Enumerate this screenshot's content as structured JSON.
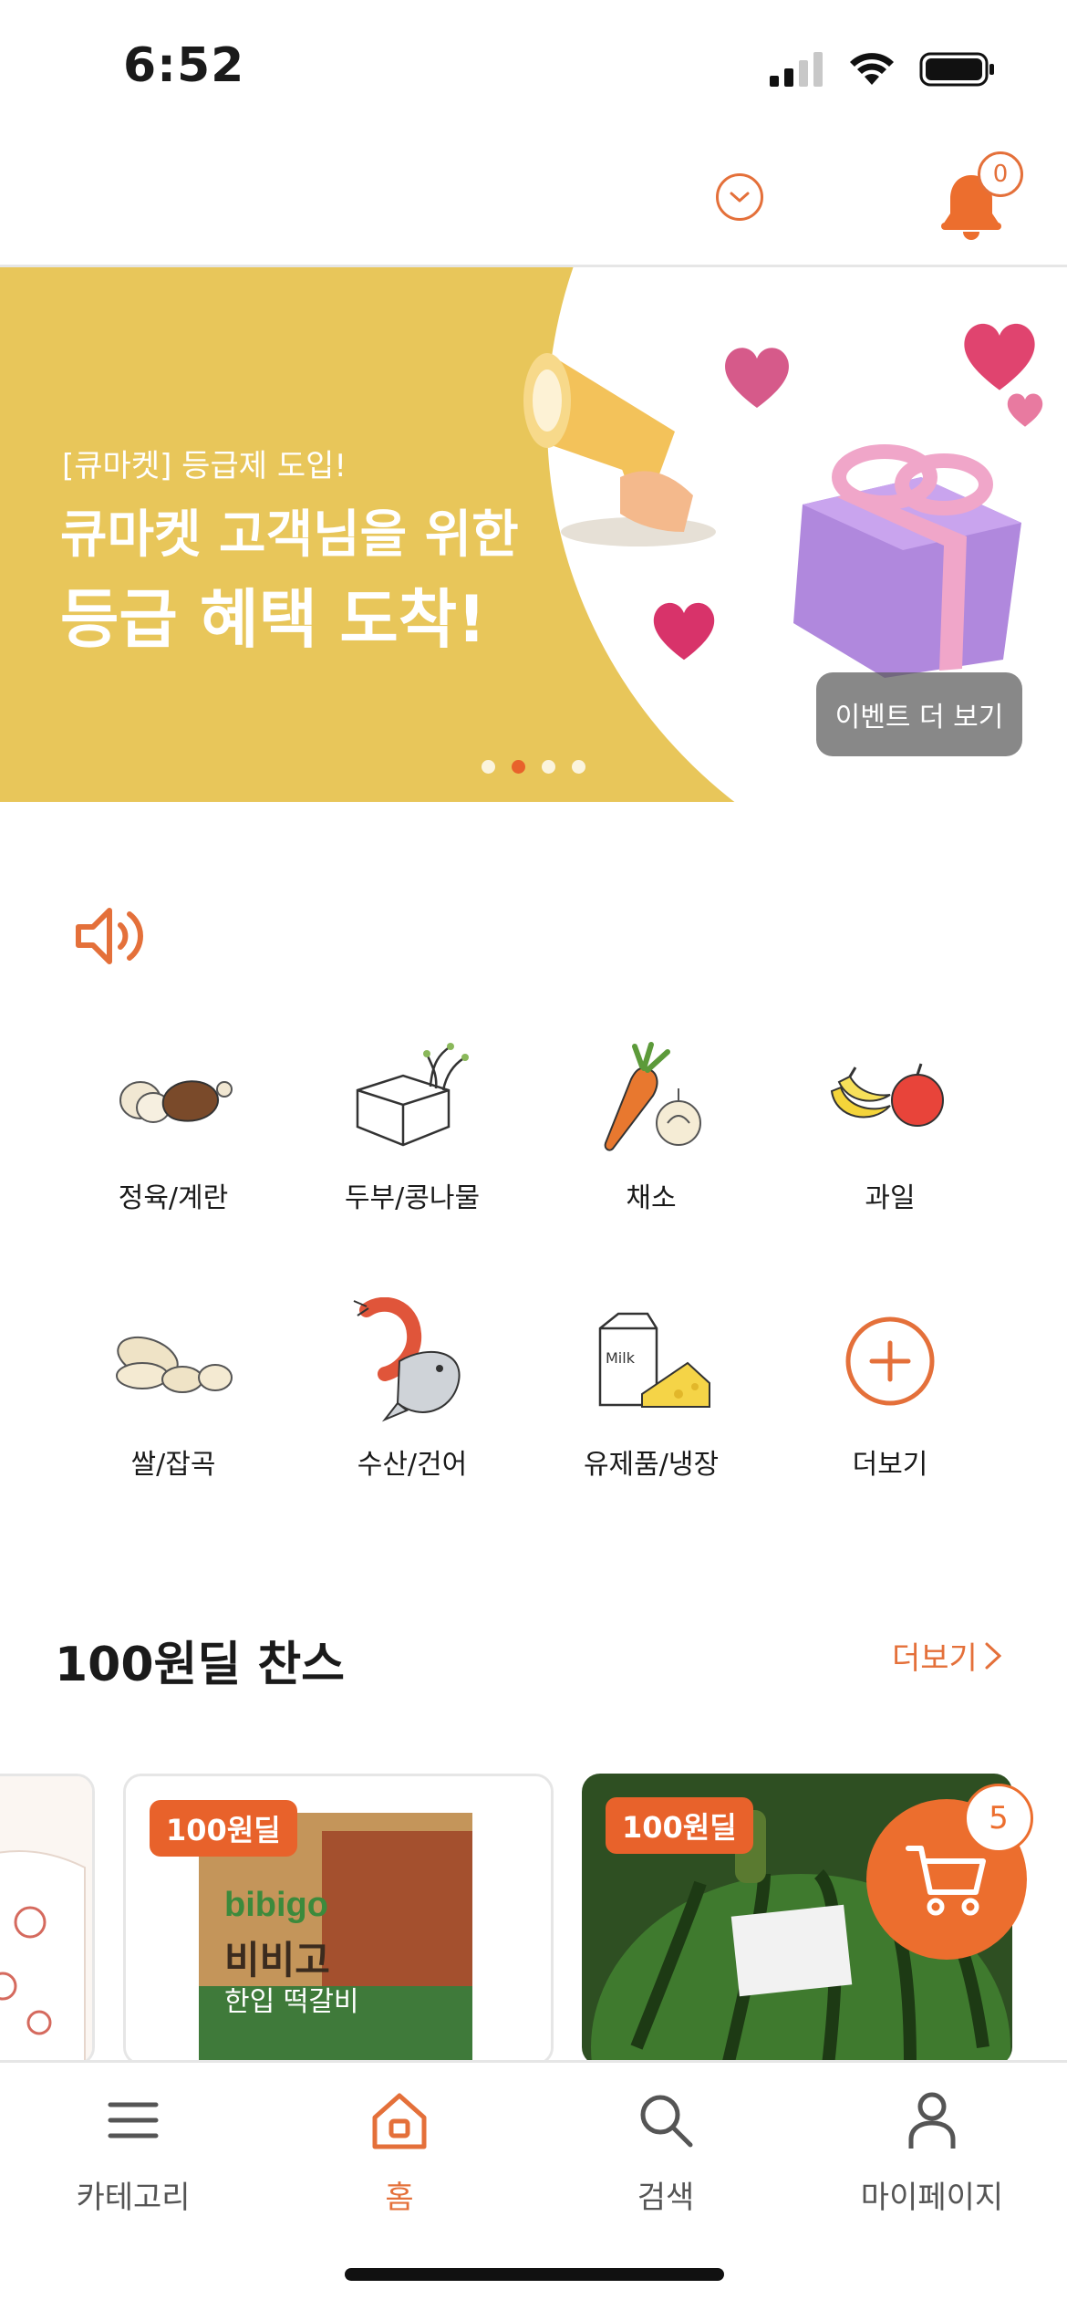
{
  "status_bar": {
    "time": "6:52"
  },
  "header": {
    "notification_count": "0"
  },
  "banner": {
    "subtitle": "[큐마켓] 등급제 도입!",
    "title_line1": "큐마켓 고객님을 위한",
    "title_line2": "등급 혜택 도착!",
    "event_button": "이벤트 더 보기",
    "page_count": 4,
    "active_page": 2
  },
  "categories": [
    {
      "label": "정육/계란",
      "icon": "meat-egg-icon"
    },
    {
      "label": "두부/콩나물",
      "icon": "tofu-sprout-icon"
    },
    {
      "label": "채소",
      "icon": "vegetable-icon"
    },
    {
      "label": "과일",
      "icon": "fruit-icon"
    },
    {
      "label": "쌀/잡곡",
      "icon": "grain-icon"
    },
    {
      "label": "수산/건어",
      "icon": "seafood-icon"
    },
    {
      "label": "유제품/냉장",
      "icon": "dairy-icon"
    },
    {
      "label": "더보기",
      "icon": "plus-circle-icon"
    }
  ],
  "deal_section": {
    "title": "100원딜 찬스",
    "more_label": "더보기",
    "products": [
      {
        "badge": ""
      },
      {
        "badge": "100원딜",
        "brand_text": "bibigo",
        "product_text": "비비고",
        "product_sub": "한입 떡갈비"
      },
      {
        "badge": "100원딜"
      }
    ]
  },
  "cart": {
    "count": "5"
  },
  "bottom_nav": [
    {
      "label": "카테고리",
      "icon": "menu-icon"
    },
    {
      "label": "홈",
      "icon": "home-icon",
      "active": true
    },
    {
      "label": "검색",
      "icon": "search-icon"
    },
    {
      "label": "마이페이지",
      "icon": "person-icon"
    }
  ],
  "colors": {
    "accent": "#e4703a",
    "banner_bg": "#e8c65a",
    "badge": "#e8622b"
  }
}
